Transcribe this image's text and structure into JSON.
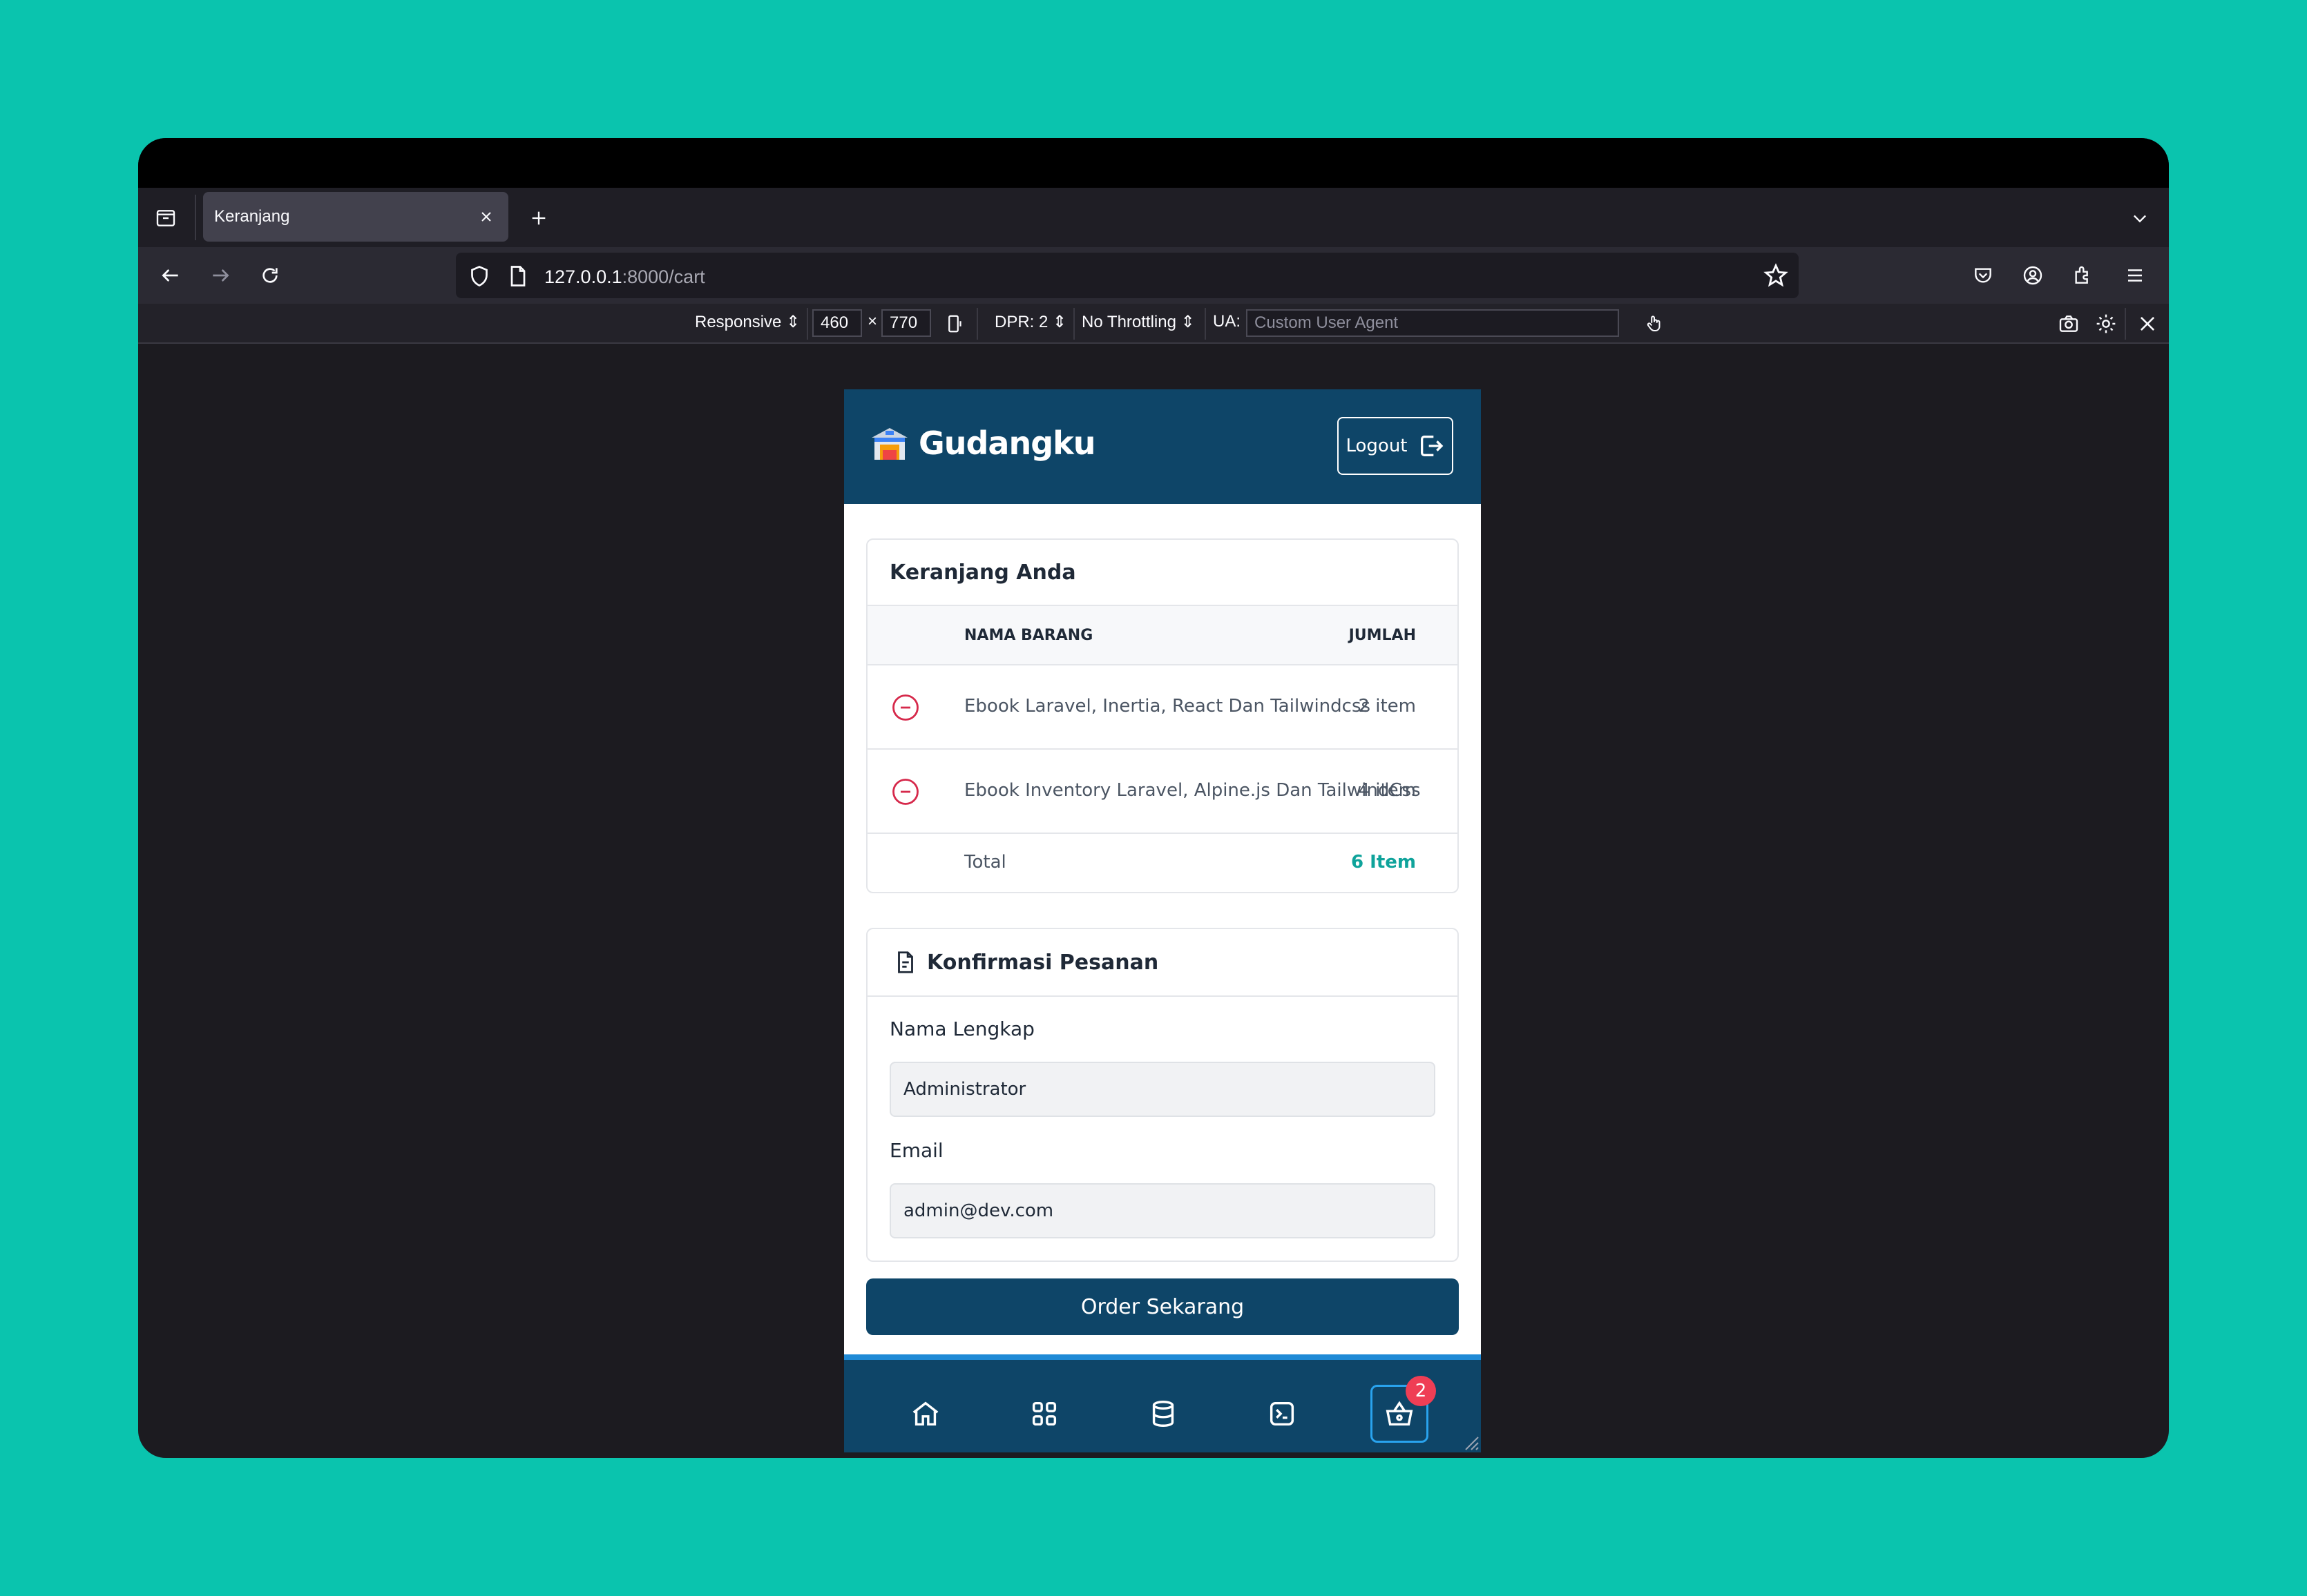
{
  "browser": {
    "tab_title": "Keranjang",
    "url_host": "127.0.0.1",
    "url_rest": ":8000/cart"
  },
  "devtools": {
    "mode": "Responsive",
    "width": "460",
    "times": "×",
    "height": "770",
    "dpr": "DPR: 2",
    "throttling": "No Throttling",
    "ua_label": "UA:",
    "ua_placeholder": "Custom User Agent"
  },
  "app": {
    "brand": "Gudangku",
    "logout_label": "Logout",
    "cart": {
      "title": "Keranjang Anda",
      "col_name": "NAMA BARANG",
      "col_qty": "JUMLAH",
      "items": [
        {
          "name": "Ebook Laravel, Inertia, React Dan Tailwindcss",
          "qty": "2 item"
        },
        {
          "name": "Ebook Inventory Laravel, Alpine.js Dan TailwindCss",
          "qty": "4 item"
        }
      ],
      "total_label": "Total",
      "total_value": "6 Item"
    },
    "confirm": {
      "title": "Konfirmasi Pesanan",
      "name_label": "Nama Lengkap",
      "name_value": "Administrator",
      "email_label": "Email",
      "email_value": "admin@dev.com"
    },
    "order_button": "Order Sekarang",
    "cart_badge": "2"
  },
  "colors": {
    "page_bg": "#0ac4ae",
    "app_primary": "#0e4568",
    "total_accent": "#0fa39b",
    "badge": "#ef3e55"
  }
}
